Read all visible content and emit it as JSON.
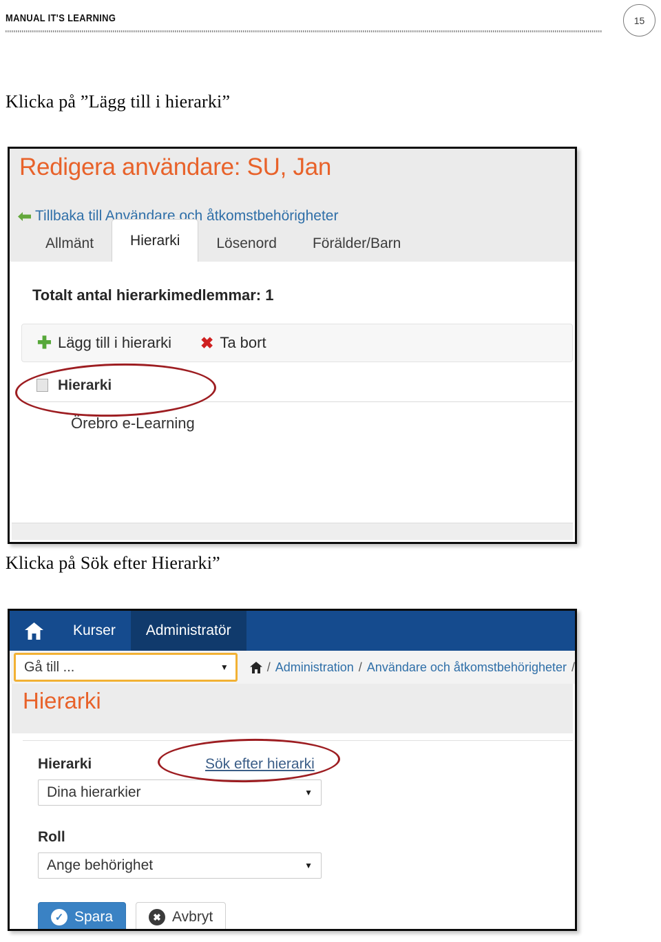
{
  "page_header": {
    "title": "MANUAL IT'S LEARNING",
    "page_number": "15"
  },
  "instructions": [
    {
      "id": "step-1",
      "text": "Klicka på ”Lägg till i hierarki”"
    },
    {
      "id": "step-2",
      "text": "Klicka på Sök efter Hierarki”"
    }
  ],
  "screenshot_1": {
    "title": "Redigera användare: SU, Jan",
    "back_link": "Tillbaka till Användare och åtkomstbehörigheter",
    "back_icon": "left-arrow-icon",
    "tabs": [
      {
        "label": "Allmänt",
        "active": false
      },
      {
        "label": "Hierarki",
        "active": true
      },
      {
        "label": "Lösenord",
        "active": false
      },
      {
        "label": "Förälder/Barn",
        "active": false
      }
    ],
    "total_members": "Totalt antal hierarkimedlemmar: 1",
    "toolbar": {
      "add_label": "Lägg till i hierarki",
      "add_icon": "plus-icon",
      "delete_label": "Ta bort",
      "delete_icon": "x-mark-icon"
    },
    "table": {
      "header": "Hierarki",
      "rows": [
        "Örebro e-Learning"
      ]
    },
    "colors": {
      "title": "#e8622a",
      "link": "#2f6fa8",
      "plus": "#57a83a",
      "delete": "#cf2020"
    }
  },
  "screenshot_2": {
    "navbar": {
      "home_icon": "home-icon",
      "items": [
        {
          "label": "Kurser",
          "active": false
        },
        {
          "label": "Administratör",
          "active": true
        }
      ]
    },
    "goto_select": {
      "value": "Gå till ...",
      "caret_icon": "chevron-down-icon"
    },
    "breadcrumb": {
      "home_icon": "home-icon",
      "sep": "/",
      "items": [
        "Administration",
        "Användare och åtkomstbehörigheter"
      ],
      "trailing_sep": "/"
    },
    "title": "Hierarki",
    "form": {
      "hierarki_label": "Hierarki",
      "search_link": "Sök efter hierarki",
      "hierarki_value": "Dina hierarkier",
      "roll_label": "Roll",
      "roll_value": "Ange behörighet",
      "save_label": "Spara",
      "save_icon": "check-circle-icon",
      "cancel_label": "Avbryt",
      "cancel_icon": "x-circle-icon"
    },
    "colors": {
      "navbar": "#154b8e",
      "navbar_active": "#103a6c",
      "accent_yellow": "#f2b134",
      "title": "#e8622a",
      "primary_button": "#3a82c4"
    }
  },
  "annotations": {
    "color": "#9d1d21",
    "shapes": [
      {
        "name": "circle-add-to-hierarchy",
        "target": "Lägg till i hierarki"
      },
      {
        "name": "circle-search-hierarchy",
        "target": "Sök efter hierarki"
      }
    ]
  }
}
